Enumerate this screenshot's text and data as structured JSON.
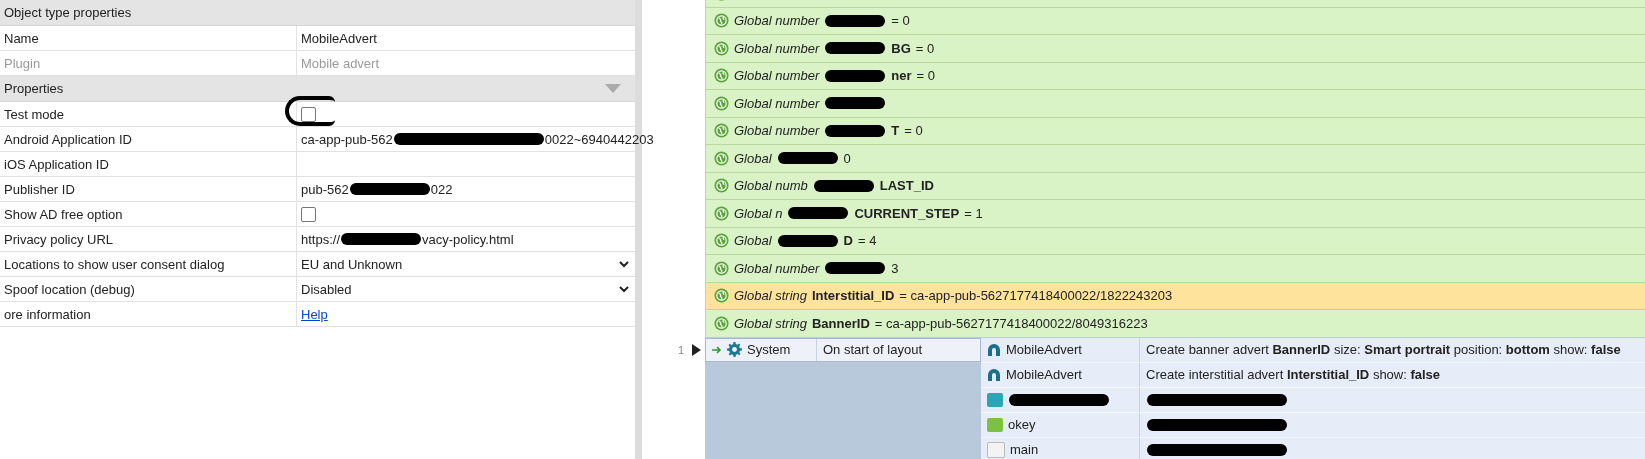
{
  "properties": {
    "sections": [
      {
        "title": "Object type properties",
        "rows": [
          {
            "kind": "text",
            "label": "Name",
            "value": "MobileAdvert",
            "disabled": false
          },
          {
            "kind": "text",
            "label": "Plugin",
            "value": "Mobile advert",
            "disabled": true
          }
        ]
      },
      {
        "title": "Properties",
        "rows": [
          {
            "kind": "checkbox",
            "label": "Test mode",
            "checked": false,
            "circled": true
          },
          {
            "kind": "redacted",
            "label": "Android Application ID",
            "parts": [
              "ca-app-pub-562",
              "0022~6940442203"
            ]
          },
          {
            "kind": "text",
            "label": "iOS Application ID"
          },
          {
            "kind": "redacted",
            "label": "Publisher ID",
            "parts": [
              "pub-562",
              "022"
            ]
          },
          {
            "kind": "checkbox",
            "label": "Show AD free option",
            "checked": false,
            "circled": false
          },
          {
            "kind": "redacted",
            "label": "Privacy policy URL",
            "parts": [
              "https://",
              "vacy-policy.html"
            ]
          },
          {
            "kind": "select",
            "label": "Locations to show user consent dialog",
            "value": "EU and Unknown"
          },
          {
            "kind": "select",
            "label": "Spoof location (debug)",
            "value": "Disabled"
          },
          {
            "kind": "link",
            "label": "ore information",
            "value": "Help"
          }
        ]
      }
    ]
  },
  "globals": [
    {
      "lead": "Global number",
      "redacted": true,
      "value": "= 0",
      "selected": false
    },
    {
      "lead": "Global number",
      "redacted": true,
      "name": "BG",
      "value": "= 0",
      "selected": false
    },
    {
      "lead": "Global number",
      "redacted": true,
      "name": "ner",
      "value": "= 0",
      "selected": false
    },
    {
      "lead": "Global number",
      "redacted": true,
      "selected": false
    },
    {
      "lead": "Global number",
      "redacted": true,
      "name": "T",
      "value": "= 0",
      "selected": false
    },
    {
      "lead": "Global",
      "redacted": true,
      "value": "0",
      "selected": false
    },
    {
      "lead": "Global numb",
      "redacted": true,
      "name": "LAST_ID",
      "selected": false
    },
    {
      "lead": "Global n",
      "redacted": true,
      "name": "CURRENT_STEP",
      "value": "= 1",
      "selected": false
    },
    {
      "lead": "Global",
      "redacted": true,
      "name": "D",
      "value": "= 4",
      "selected": false
    },
    {
      "lead": "Global number",
      "redacted": true,
      "value": "3",
      "selected": false
    },
    {
      "lead": "Global string",
      "redacted": false,
      "name": "Interstitial_ID",
      "value": "= ca-app-pub-5627177418400022/1822243203",
      "selected": true
    },
    {
      "lead": "Global string",
      "redacted": false,
      "name": "BannerID",
      "value": "= ca-app-pub-5627177418400022/8049316223",
      "selected": false
    }
  ],
  "event": {
    "number": "1",
    "object": "System",
    "condition": "On start of layout",
    "actions": [
      {
        "kind": "advert",
        "redacted": false,
        "object": "MobileAdvert",
        "text": "Create banner advert **BannerID** size: **Smart portrait** position: **bottom** show: **false**"
      },
      {
        "kind": "advert",
        "redacted": false,
        "object": "MobileAdvert",
        "text": "Create interstitial advert **Interstitial_ID** show: **false**"
      },
      {
        "kind": "teal",
        "redacted": true
      },
      {
        "kind": "green",
        "object": "okey",
        "redacted": true
      },
      {
        "kind": "plain",
        "object": "main",
        "redacted": true
      }
    ]
  }
}
